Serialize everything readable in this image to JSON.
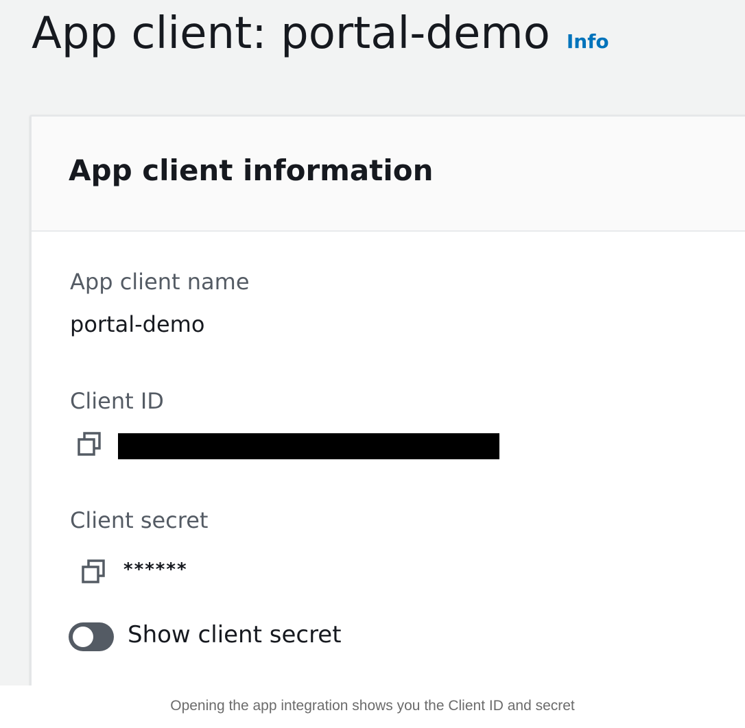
{
  "header": {
    "title": "App client: portal-demo",
    "info_link": "Info"
  },
  "panel": {
    "title": "App client information",
    "fields": {
      "name": {
        "label": "App client name",
        "value": "portal-demo"
      },
      "client_id": {
        "label": "Client ID",
        "value_redacted": true
      },
      "client_secret": {
        "label": "Client secret",
        "value": "******"
      }
    },
    "toggle": {
      "label": "Show client secret",
      "on": false
    }
  },
  "icons": {
    "copy": "copy-icon"
  },
  "colors": {
    "page_bg": "#f2f3f3",
    "link": "#0073bb",
    "toggle_off": "#545b64",
    "label": "#545b64",
    "text": "#16191f"
  },
  "caption": "Opening the app integration shows you the Client ID and secret"
}
